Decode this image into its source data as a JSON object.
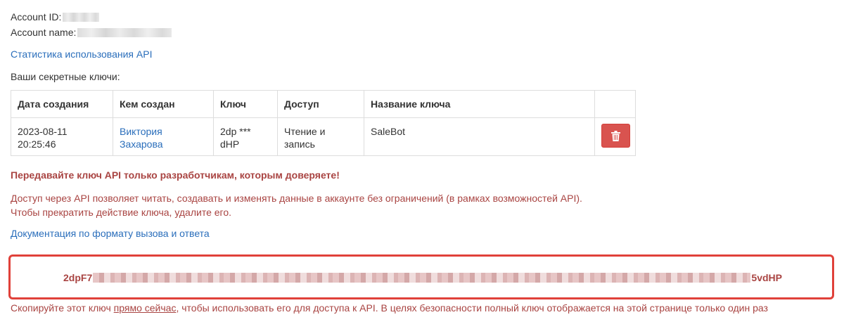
{
  "account": {
    "id_label": "Account ID:",
    "name_label": "Account name:"
  },
  "links": {
    "stats": "Статистика использования API",
    "docs": "Документация по формату вызова и ответа"
  },
  "keys_heading": "Ваши секретные ключи:",
  "table": {
    "headers": [
      "Дата создания",
      "Кем создан",
      "Ключ",
      "Доступ",
      "Название ключа",
      ""
    ],
    "rows": [
      {
        "created": "2023-08-11 20:25:46",
        "author": "Виктория Захарова",
        "key": "2dp *** dHP",
        "access": "Чтение и запись",
        "name": "SaleBot"
      }
    ]
  },
  "warning": {
    "bold": "Передавайте ключ API только разработчикам, которым доверяете!",
    "line1": "Доступ через API позволяет читать, создавать и изменять данные в аккаунте без ограничений (в рамках возможностей API).",
    "line2": "Чтобы прекратить действие ключа, удалите его."
  },
  "full_key": {
    "prefix": "2dpF7",
    "suffix": "5vdHP"
  },
  "bottom_note": {
    "before": "Скопируйте этот ключ ",
    "underlined": "прямо сейчас",
    "after": ", чтобы использовать его для доступа к API. В целях безопасности полный ключ отображается на этой странице только один раз"
  },
  "icons": {
    "delete": "trash-icon"
  },
  "colors": {
    "link": "#2a6ebb",
    "danger_text": "#a94442",
    "delete_button": "#d9534f",
    "highlight_border": "#e0413a"
  }
}
